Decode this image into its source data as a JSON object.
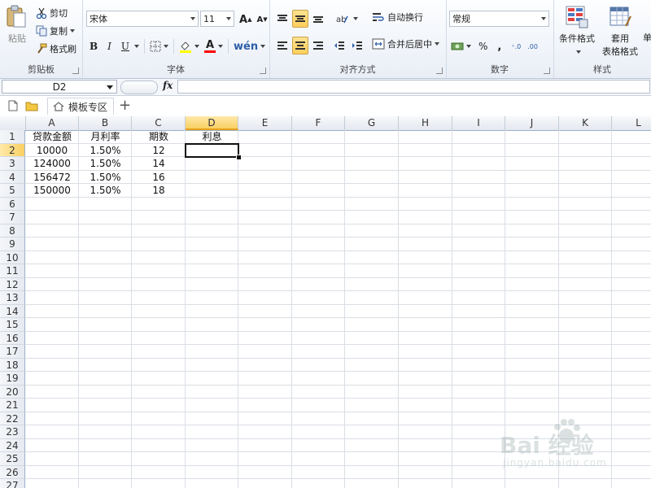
{
  "ribbon": {
    "clipboard": {
      "paste_label": "粘贴",
      "cut_label": "剪切",
      "copy_label": "复制",
      "format_painter_label": "格式刷",
      "group_label": "剪贴板"
    },
    "font": {
      "font_name": "宋体",
      "font_size": "11",
      "bold": "B",
      "italic": "I",
      "underline": "U",
      "font_color_glyph": "A",
      "group_label": "字体"
    },
    "alignment": {
      "wrap_text_label": "自动换行",
      "merge_center_label": "合并后居中",
      "group_label": "对齐方式"
    },
    "number": {
      "format": "常规",
      "percent": "%",
      "comma": ",",
      "inc_decimal": "⁺.0",
      "dec_decimal": ".00",
      "group_label": "数字"
    },
    "styles": {
      "conditional_format_label": "条件格式",
      "table_format_label_1": "套用",
      "table_format_label_2": "表格格式",
      "cell_styles_label": "单",
      "group_label": "样式"
    }
  },
  "formula_bar": {
    "name_box": "D2",
    "fx": "fx",
    "formula": ""
  },
  "tabs": {
    "template_tab": "模板专区",
    "add_tab": "+"
  },
  "grid": {
    "columns": [
      "A",
      "B",
      "C",
      "D",
      "E",
      "F",
      "G",
      "H",
      "I",
      "J",
      "K",
      "L"
    ],
    "rows": [
      "1",
      "2",
      "3",
      "4",
      "5",
      "6",
      "7",
      "8",
      "9",
      "10",
      "11",
      "12",
      "13",
      "14",
      "15",
      "16",
      "17",
      "18",
      "19",
      "20",
      "21",
      "22",
      "23",
      "24",
      "25",
      "26",
      "27"
    ],
    "selected_column": "D",
    "selected_row": "2",
    "headers": [
      "贷款金额",
      "月利率",
      "期数",
      "利息"
    ],
    "data": [
      [
        "10000",
        "1.50%",
        "12"
      ],
      [
        "124000",
        "1.50%",
        "14"
      ],
      [
        "156472",
        "1.50%",
        "16"
      ],
      [
        "150000",
        "1.50%",
        "18"
      ]
    ]
  },
  "watermark": {
    "brand": "Bai 经验",
    "url": "jingyan.baidu.com"
  }
}
